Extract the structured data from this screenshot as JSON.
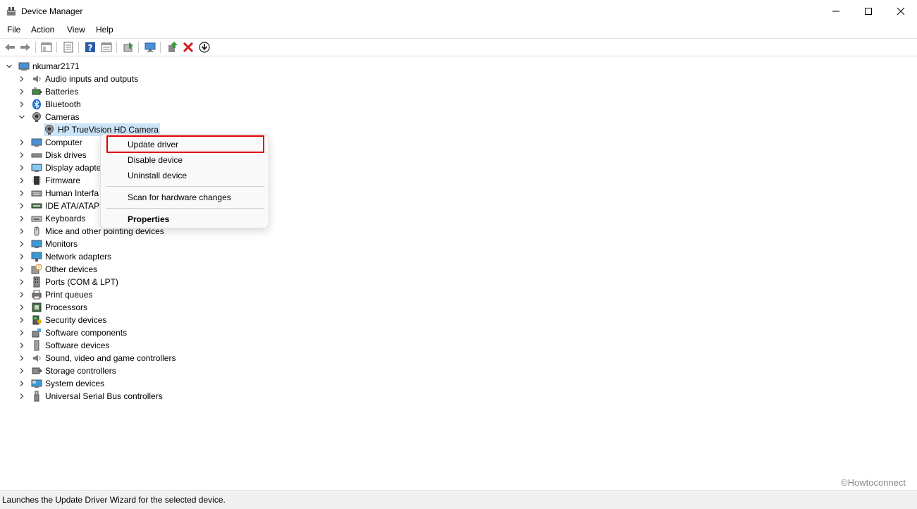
{
  "window": {
    "title": "Device Manager",
    "minimize_icon": "minimize-icon",
    "maximize_icon": "maximize-icon",
    "close_icon": "close-icon"
  },
  "menu": [
    "File",
    "Action",
    "View",
    "Help"
  ],
  "toolbar_icons": [
    "back-icon",
    "forward-icon",
    "show-hide-console-tree-icon",
    "properties-icon",
    "help-icon",
    "view-icon",
    "scan-icon",
    "monitor-icon",
    "update-driver-icon",
    "uninstall-icon",
    "download-icon"
  ],
  "tree": {
    "root": "nkumar2171",
    "categories": [
      {
        "label": "Audio inputs and outputs",
        "icon": "speaker-icon",
        "expanded": false
      },
      {
        "label": "Batteries",
        "icon": "battery-icon",
        "expanded": false
      },
      {
        "label": "Bluetooth",
        "icon": "bluetooth-icon",
        "expanded": false
      },
      {
        "label": "Cameras",
        "icon": "camera-icon",
        "expanded": true,
        "children": [
          "HP TrueVision HD Camera"
        ]
      },
      {
        "label": "Computer",
        "icon": "computer-icon",
        "expanded": false
      },
      {
        "label": "Disk drives",
        "icon": "disk-icon",
        "expanded": false
      },
      {
        "label": "Display adapte",
        "icon": "display-icon",
        "expanded": false
      },
      {
        "label": "Firmware",
        "icon": "firmware-icon",
        "expanded": false
      },
      {
        "label": "Human Interfa",
        "icon": "hid-icon",
        "expanded": false
      },
      {
        "label": "IDE ATA/ATAPI",
        "icon": "ide-icon",
        "expanded": false
      },
      {
        "label": "Keyboards",
        "icon": "keyboard-icon",
        "expanded": false
      },
      {
        "label": "Mice and other pointing devices",
        "icon": "mouse-icon",
        "expanded": false
      },
      {
        "label": "Monitors",
        "icon": "monitor-icon",
        "expanded": false
      },
      {
        "label": "Network adapters",
        "icon": "network-icon",
        "expanded": false
      },
      {
        "label": "Other devices",
        "icon": "unknown-device-icon",
        "expanded": false
      },
      {
        "label": "Ports (COM & LPT)",
        "icon": "port-icon",
        "expanded": false
      },
      {
        "label": "Print queues",
        "icon": "printer-icon",
        "expanded": false
      },
      {
        "label": "Processors",
        "icon": "processor-icon",
        "expanded": false
      },
      {
        "label": "Security devices",
        "icon": "security-icon",
        "expanded": false
      },
      {
        "label": "Software components",
        "icon": "software-component-icon",
        "expanded": false
      },
      {
        "label": "Software devices",
        "icon": "software-device-icon",
        "expanded": false
      },
      {
        "label": "Sound, video and game controllers",
        "icon": "sound-icon",
        "expanded": false
      },
      {
        "label": "Storage controllers",
        "icon": "storage-icon",
        "expanded": false
      },
      {
        "label": "System devices",
        "icon": "system-icon",
        "expanded": false
      },
      {
        "label": "Universal Serial Bus controllers",
        "icon": "usb-icon",
        "expanded": false
      }
    ]
  },
  "context_menu": {
    "items": [
      "Update driver",
      "Disable device",
      "Uninstall device",
      "Scan for hardware changes",
      "Properties"
    ],
    "highlighted": "Update driver"
  },
  "status": "Launches the Update Driver Wizard for the selected device.",
  "watermark": "©Howtoconnect",
  "colors": {
    "selection": "#cce4f7",
    "highlight_border": "#e00000",
    "accent_blue": "#0067c0"
  }
}
